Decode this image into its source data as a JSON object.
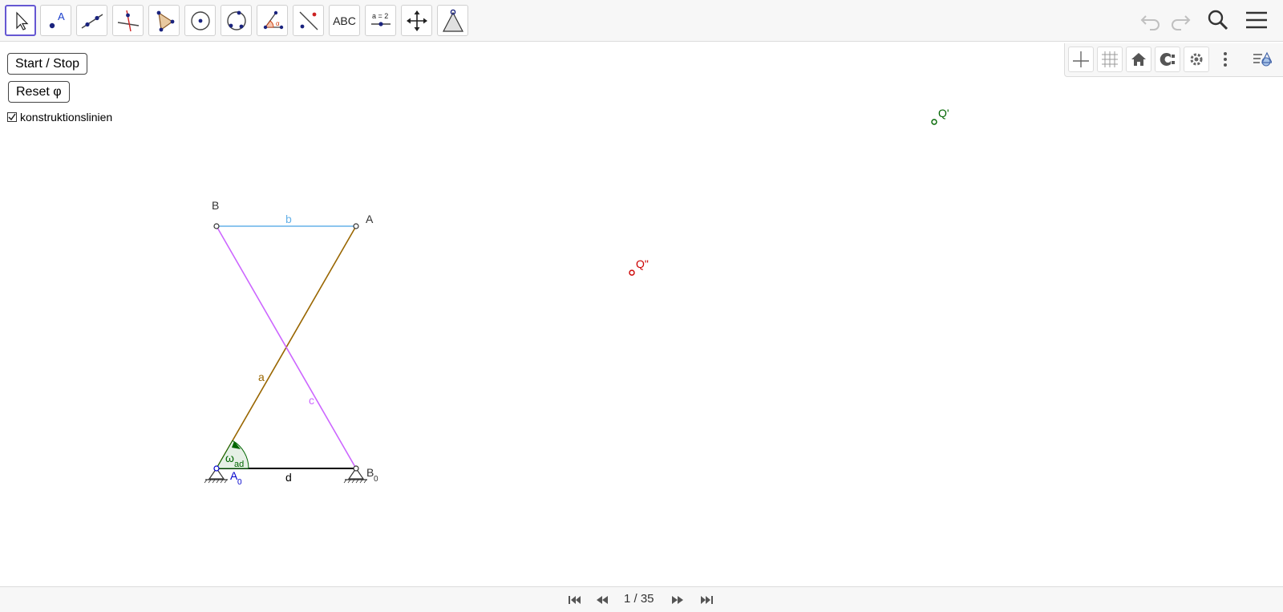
{
  "toolbar": {
    "tools": [
      {
        "name": "move-tool",
        "selected": true
      },
      {
        "name": "point-tool",
        "label": "A"
      },
      {
        "name": "line-tool"
      },
      {
        "name": "perpendicular-line-tool"
      },
      {
        "name": "polygon-tool"
      },
      {
        "name": "circle-tool"
      },
      {
        "name": "circle-through-3-points-tool"
      },
      {
        "name": "angle-tool",
        "label": "α"
      },
      {
        "name": "reflect-tool"
      },
      {
        "name": "text-tool",
        "label": "ABC"
      },
      {
        "name": "slider-tool",
        "label": "a = 2"
      },
      {
        "name": "move-graphics-view-tool"
      },
      {
        "name": "custom-tool"
      }
    ],
    "actions": [
      "undo-icon",
      "redo-icon",
      "search-icon",
      "menu-icon"
    ]
  },
  "stylebar": {
    "buttons": [
      "axes-toggle-icon",
      "grid-toggle-icon",
      "home-icon",
      "point-capturing-icon",
      "settings-icon",
      "more-options-icon",
      "style-bar-toggle-icon"
    ]
  },
  "controls": {
    "start_stop_label": "Start / Stop",
    "reset_label": "Reset φ",
    "checkbox_label": "konstruktionslinien",
    "checkbox_checked": true
  },
  "construction": {
    "points": {
      "A0": "A",
      "A0_sub": "0",
      "B0": "B",
      "B0_sub": "0",
      "A": "A",
      "B": "B",
      "Q1": "Q'",
      "Q2": "Q\""
    },
    "segments": {
      "a": "a",
      "b": "b",
      "c": "c",
      "d": "d"
    },
    "angle_label": "ω",
    "angle_sub": "ad",
    "colors": {
      "a": "#996600",
      "b": "#66b2e8",
      "c": "#cc66ff",
      "d": "#000000",
      "A0": "#0000cc",
      "Q1": "#006600",
      "Q2": "#cc0000",
      "angle": "#006600",
      "angle_fill": "#e6f0e6"
    }
  },
  "navigation": {
    "page_text": "1 / 35",
    "buttons": [
      "first-page-icon",
      "previous-page-icon",
      "next-page-icon",
      "last-page-icon"
    ]
  }
}
